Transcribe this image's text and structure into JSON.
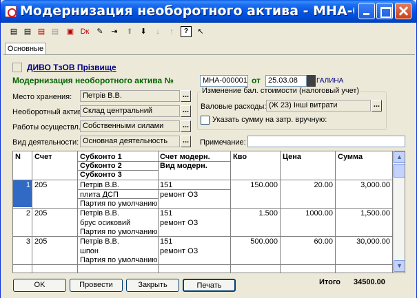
{
  "window": {
    "title": "Модернизация необоротного актива - МНА-00...",
    "controls": {
      "minimize": "minimize",
      "maximize": "maximize",
      "close": "close"
    }
  },
  "toolbar": {
    "icons": [
      "new-icon",
      "copy-icon",
      "delete-icon",
      "save-icon",
      "post-icon",
      "unpost-icon",
      "edit-icon",
      "insert-icon",
      "move-up-icon",
      "move-down-icon",
      "sort-asc-icon",
      "sort-desc-icon",
      "help-icon",
      "whats-this-icon"
    ]
  },
  "tabs": [
    {
      "label": "Основные"
    }
  ],
  "header": {
    "link": "ДИВО ТзОВ Прізвище",
    "doc_title": "Модернизация необоротного актива №",
    "doc_number": "МНА-000001",
    "date_label": "от",
    "date_value": "25.03.08",
    "author": "ГАЛИНА"
  },
  "fields": {
    "storage": {
      "label": "Место хранения:",
      "value": "Петрів В.В."
    },
    "asset": {
      "label": "Необоротный актив:",
      "value": "Склад центральний"
    },
    "works": {
      "label": "Работы осуществл.:",
      "value": "Собственными силами"
    },
    "activity": {
      "label": "Вид деятельности:",
      "value": "Основная деятельность"
    },
    "note": {
      "label": "Примечание:",
      "value": ""
    }
  },
  "balance_group": {
    "title": "Изменение бал. стоимости (налоговый учет)",
    "gross_label": "Валовые расходы:",
    "gross_value": "(Ж 23) Інші витрати",
    "checkbox_label": "Указать сумму на затр. вручную:"
  },
  "grid": {
    "columns": {
      "n": "N",
      "account": "Счет",
      "sub1": "Субконто 1",
      "sub2": "Субконто 2",
      "sub3": "Субконто 3",
      "mod_account": "Счет модерн.",
      "mod_type": "Вид модерн.",
      "qty": "Кво",
      "price": "Цена",
      "sum": "Сумма"
    },
    "rows": [
      {
        "n": "1",
        "account": "205",
        "sub1": "Петрів В.В.",
        "sub2": "плита ДСП",
        "sub3": "Партия по умолчанию",
        "mod_account": "151",
        "mod_type": "ремонт ОЗ",
        "qty": "150.000",
        "price": "20.00",
        "sum": "3,000.00"
      },
      {
        "n": "2",
        "account": "205",
        "sub1": "Петрів В.В.",
        "sub2": "брус осиковий",
        "sub3": "Партия по умолчанию",
        "mod_account": "151",
        "mod_type": "ремонт ОЗ",
        "qty": "1.500",
        "price": "1000.00",
        "sum": "1,500.00"
      },
      {
        "n": "3",
        "account": "205",
        "sub1": "Петрів В.В.",
        "sub2": "шпон",
        "sub3": "Партия по умолчанию",
        "mod_account": "151",
        "mod_type": "ремонт ОЗ",
        "qty": "500.000",
        "price": "60.00",
        "sum": "30,000.00"
      }
    ]
  },
  "footer": {
    "ok": "OK",
    "post": "Провести",
    "close": "Закрыть",
    "print": "Печать",
    "total_label": "Итого",
    "total_value": "34500.00"
  },
  "colors": {
    "title_bar": "#0054E3",
    "doc_title": "#006400",
    "link": "#000080",
    "selection": "#316AC5"
  }
}
